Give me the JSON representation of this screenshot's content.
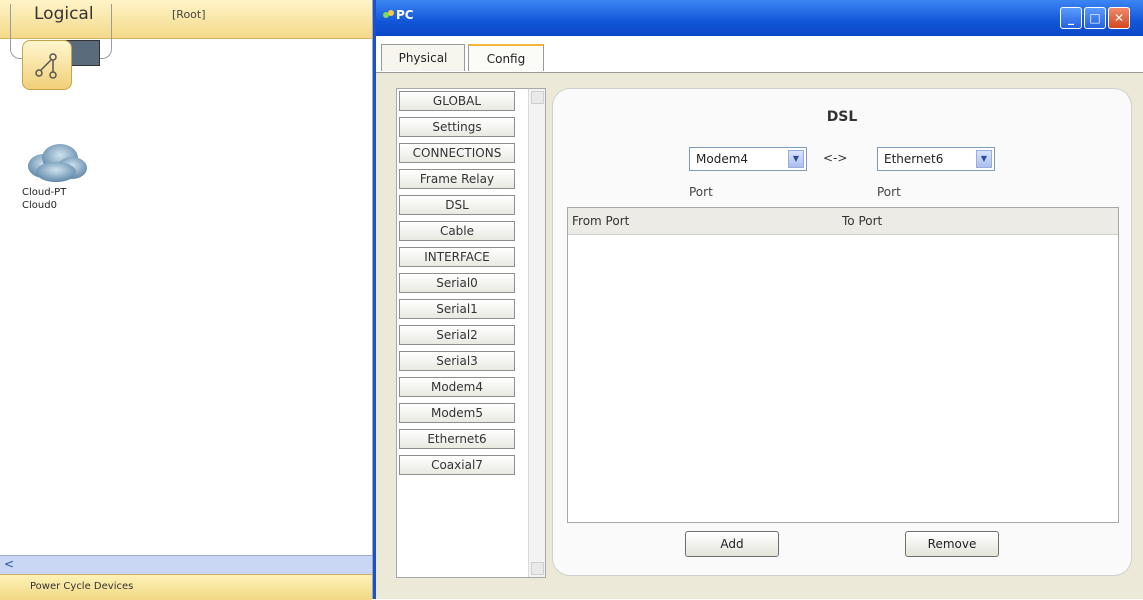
{
  "workspace": {
    "view_label": "Logical",
    "root_label": "[Root]",
    "device": {
      "type": "Cloud-PT",
      "name": "Cloud0"
    },
    "status_text": "Power Cycle Devices"
  },
  "window": {
    "title": "PC",
    "controls": {
      "minimize": "_",
      "maximize": "□",
      "close": "✕"
    },
    "tabs": [
      {
        "label": "Physical",
        "active": false
      },
      {
        "label": "Config",
        "active": true
      }
    ]
  },
  "config_list": {
    "items": [
      "GLOBAL",
      "Settings",
      "CONNECTIONS",
      "Frame Relay",
      "DSL",
      "Cable",
      "INTERFACE",
      "Serial0",
      "Serial1",
      "Serial2",
      "Serial3",
      "Modem4",
      "Modem5",
      "Ethernet6",
      "Coaxial7"
    ]
  },
  "dsl": {
    "title": "DSL",
    "left_port_value": "Modem4",
    "right_port_value": "Ethernet6",
    "swap_symbol": "<->",
    "left_port_caption": "Port",
    "right_port_caption": "Port",
    "table": {
      "columns": [
        "From Port",
        "To Port"
      ],
      "rows": []
    },
    "add_label": "Add",
    "remove_label": "Remove"
  },
  "colors": {
    "titlebar": "#1256d8",
    "workspace_bar": "#f3d98a",
    "config_tab_accent": "#f5b53a"
  }
}
